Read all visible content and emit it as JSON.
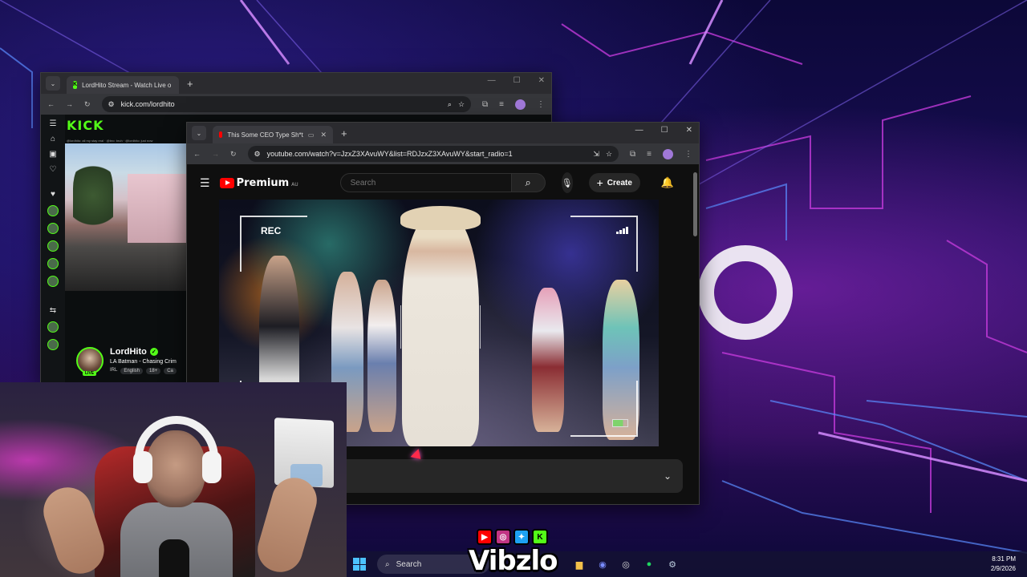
{
  "kick_window": {
    "tab_title": "LordHito Stream - Watch Live o",
    "url": "kick.com/lordhito",
    "logo": "KICK",
    "chat_snippet": "@lordhito: all my stay real · @bro: bruh · @lordhito: just now",
    "streamer": {
      "name": "LordHito",
      "live_badge": "LIVE",
      "title": "LA Batman - Chasing Crim",
      "tags": [
        "IRL",
        "English",
        "18+",
        "Ca"
      ]
    }
  },
  "youtube_window": {
    "tab_title": "This Some CEO Type Sh*t",
    "url": "youtube.com/watch?v=JzxZ3XAvuWY&list=RDJzxZ3XAvuWY&start_radio=1",
    "logo_text": "Premium",
    "region": "AU",
    "search_placeholder": "Search",
    "create_label": "Create",
    "video_overlay": {
      "rec_label": "REC"
    }
  },
  "overlay": {
    "brand": "Vibzlo",
    "socials": [
      "youtube-icon",
      "instagram-icon",
      "twitter-icon",
      "kick-icon"
    ]
  },
  "taskbar": {
    "search_label": "Search",
    "time": "8:31 PM",
    "date": "2/9/2026"
  }
}
